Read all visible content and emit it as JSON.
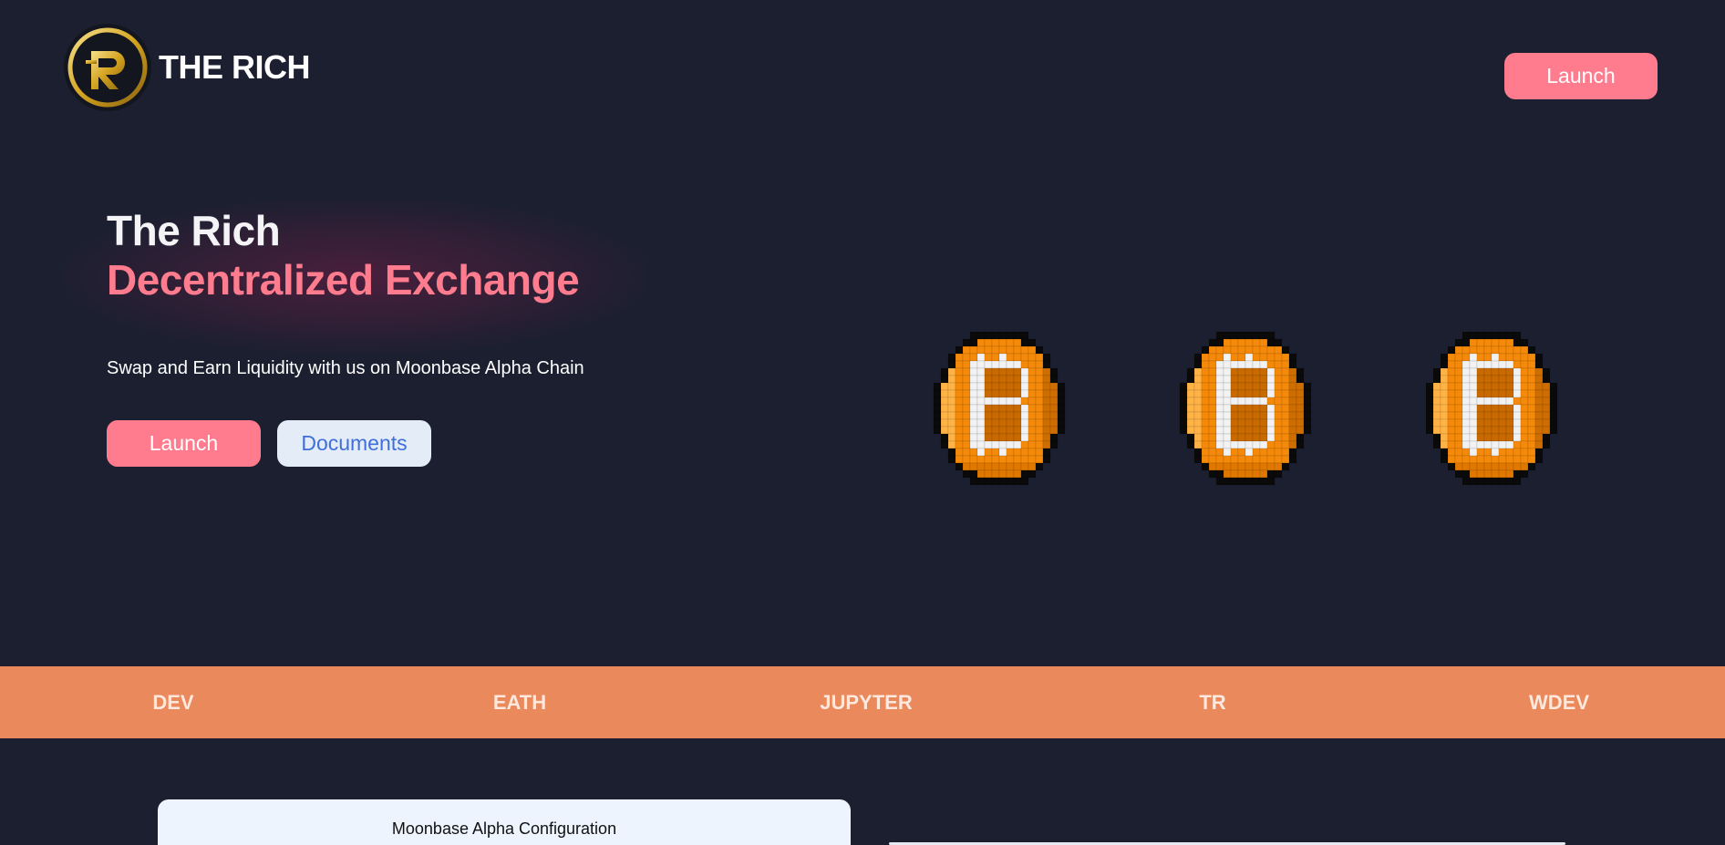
{
  "header": {
    "brand": "THE RICH",
    "logo_text": "THE RICH",
    "launch_label": "Launch"
  },
  "hero": {
    "title": "The Rich",
    "subtitle": "Decentralized Exchange",
    "description": "Swap and Earn Liquidity with us on Moonbase Alpha Chain",
    "launch_label": "Launch",
    "docs_label": "Documents"
  },
  "ticker": {
    "items": [
      "DEV",
      "EATH",
      "JUPYTER",
      "TR",
      "WDEV"
    ]
  },
  "config": {
    "title": "Moonbase Alpha Configuration"
  },
  "coins": {
    "icon": "pixel-bitcoin-icon",
    "count": 3
  },
  "colors": {
    "background": "#1b1f30",
    "accent": "#ff7b8e",
    "ticker": "#ea895b",
    "docs_bg": "#e4ecf8",
    "docs_text": "#3f6fd8"
  }
}
